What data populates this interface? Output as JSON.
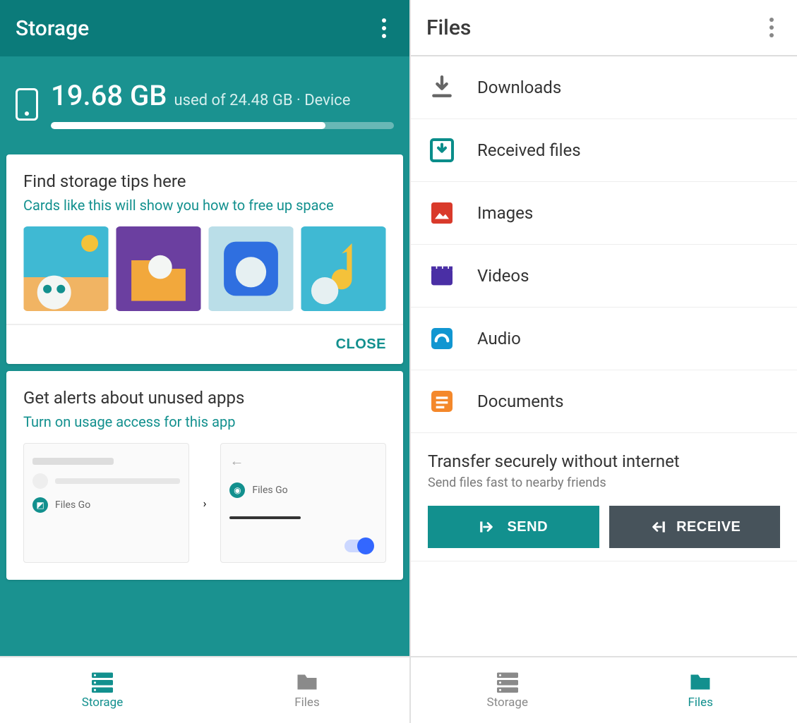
{
  "left": {
    "title": "Storage",
    "hero": {
      "size": "19.68 GB",
      "sub": "used of 24.48 GB · Device",
      "progress_pct": 80
    },
    "tips_card": {
      "title": "Find storage tips here",
      "subtitle": "Cards like this will show you how to free up space",
      "close": "CLOSE"
    },
    "alerts_card": {
      "title": "Get alerts about unused apps",
      "subtitle": "Turn on usage access for this app",
      "app_label": "Files Go"
    },
    "nav": {
      "storage": "Storage",
      "files": "Files"
    }
  },
  "right": {
    "title": "Files",
    "items": [
      {
        "label": "Downloads"
      },
      {
        "label": "Received files"
      },
      {
        "label": "Images"
      },
      {
        "label": "Videos"
      },
      {
        "label": "Audio"
      },
      {
        "label": "Documents"
      }
    ],
    "transfer": {
      "title": "Transfer securely without internet",
      "subtitle": "Send files fast to nearby friends",
      "send": "SEND",
      "receive": "RECEIVE"
    },
    "nav": {
      "storage": "Storage",
      "files": "Files"
    }
  },
  "colors": {
    "accent": "#12908e"
  }
}
